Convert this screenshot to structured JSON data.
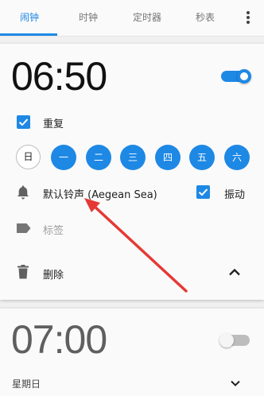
{
  "tabs": {
    "alarm": "闹钟",
    "clock": "时钟",
    "timer": "定时器",
    "stopwatch": "秒表"
  },
  "alarm1": {
    "time": "06:50",
    "enabled": true,
    "repeat_label": "重复",
    "repeat_checked": true,
    "days": [
      {
        "label": "日",
        "selected": false
      },
      {
        "label": "一",
        "selected": true
      },
      {
        "label": "二",
        "selected": true
      },
      {
        "label": "三",
        "selected": true
      },
      {
        "label": "四",
        "selected": true
      },
      {
        "label": "五",
        "selected": true
      },
      {
        "label": "六",
        "selected": true
      }
    ],
    "ringtone": "默认铃声 (Aegean Sea)",
    "vibrate_label": "振动",
    "vibrate_checked": true,
    "label_placeholder": "标签",
    "delete_label": "删除"
  },
  "alarm2": {
    "time": "07:00",
    "enabled": false,
    "subtitle": "星期日"
  },
  "colors": {
    "accent": "#1e88e5",
    "annotation_arrow": "#e53935"
  },
  "icons": [
    "overflow-menu-icon",
    "check-icon",
    "bell-icon",
    "label-tag-icon",
    "trash-icon",
    "chevron-up-icon",
    "chevron-down-icon"
  ]
}
